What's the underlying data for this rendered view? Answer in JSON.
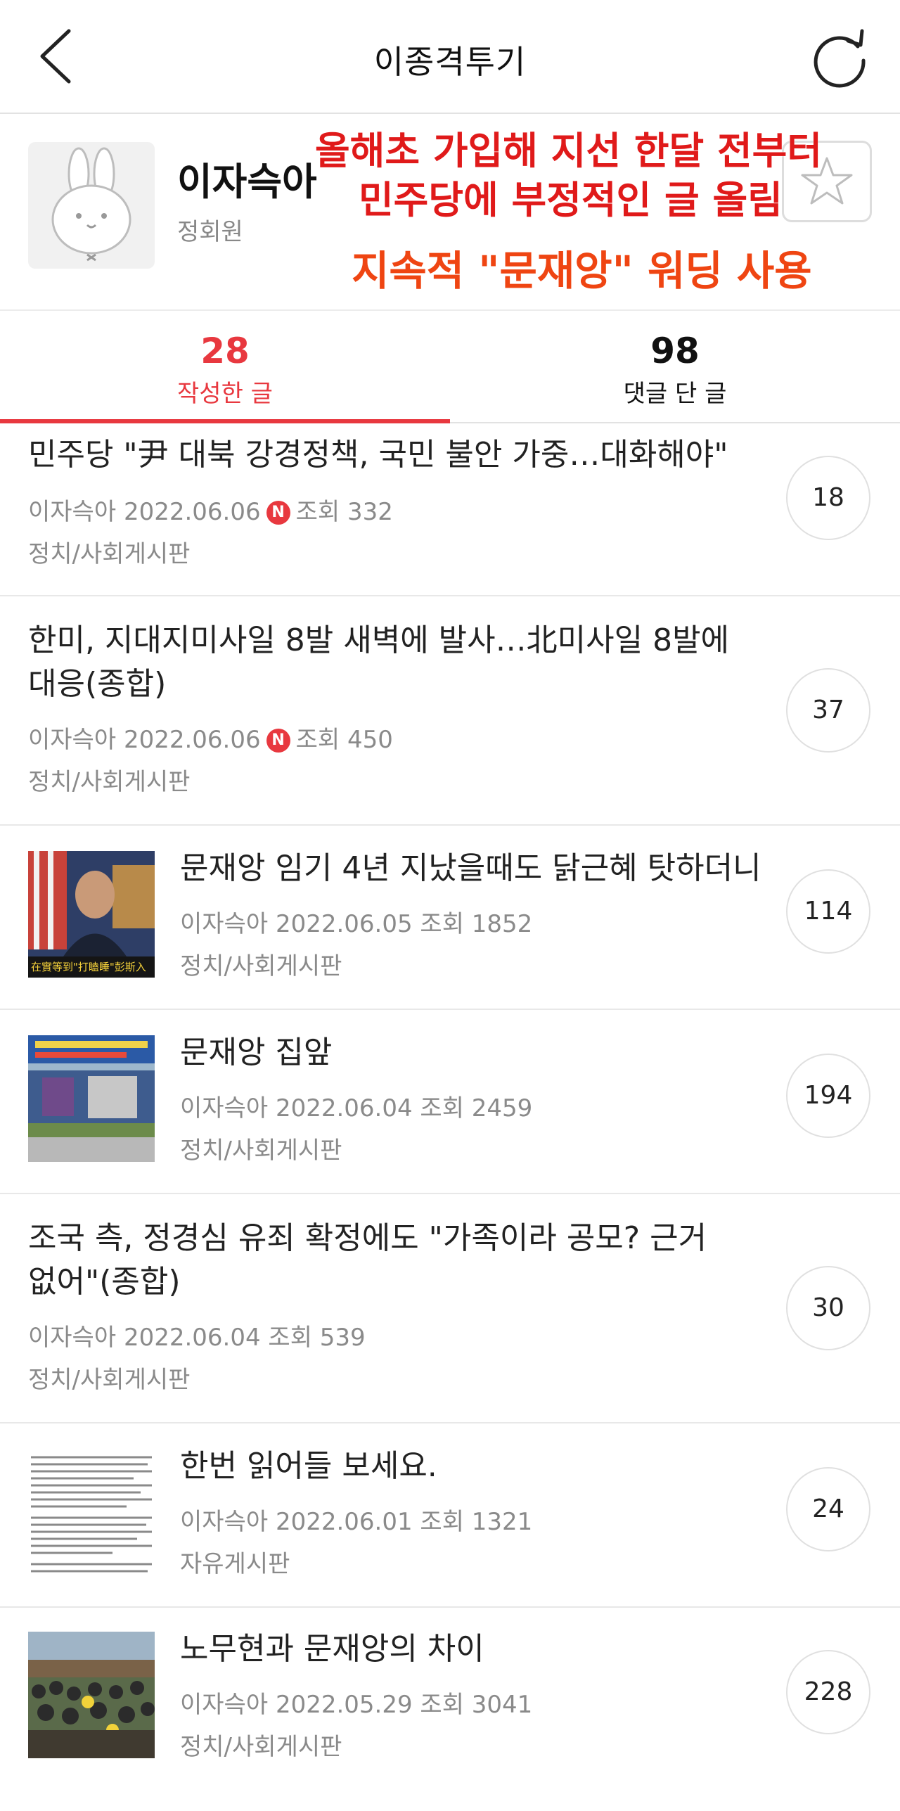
{
  "header": {
    "title": "이종격투기"
  },
  "profile": {
    "nickname": "이자슥아",
    "grade": "정회원"
  },
  "annotations": {
    "line1": "올해초 가입해 지선 한달 전부터",
    "line2": "민주당에 부정적인 글 올림",
    "line3": "지속적 \"문재앙\" 워딩 사용"
  },
  "tabs": [
    {
      "count": "28",
      "label": "작성한 글"
    },
    {
      "count": "98",
      "label": "댓글 단 글"
    }
  ],
  "posts": [
    {
      "title": "민주당 \"尹 대북 강경정책, 국민 불안 가중…대화해야\"",
      "author": "이자슥아",
      "date": "2022.06.06",
      "badge": "N",
      "views": "조회 332",
      "board": "정치/사회게시판",
      "comments": "18"
    },
    {
      "title_line1": "한미, 지대지미사일 8발 새벽에 발사…北미사일 8발에",
      "title_line2": "대응(종합)",
      "author": "이자슥아",
      "date": "2022.06.06",
      "badge": "N",
      "views": "조회 450",
      "board": "정치/사회게시판",
      "comments": "37"
    },
    {
      "title": "문재앙 임기 4년 지났을때도 닭근혜 탓하더니",
      "author": "이자슥아",
      "date": "2022.06.05",
      "views": "조회 1852",
      "board": "정치/사회게시판",
      "comments": "114",
      "thumb_caption": "在實等到\"打瞌睡\"彭斯入"
    },
    {
      "title": "문재앙 집앞",
      "author": "이자슥아",
      "date": "2022.06.04",
      "views": "조회 2459",
      "board": "정치/사회게시판",
      "comments": "194"
    },
    {
      "title_line1": "조국 측, 정경심 유죄 확정에도 \"가족이라 공모? 근거",
      "title_line2": "없어\"(종합)",
      "author": "이자슥아",
      "date": "2022.06.04",
      "views": "조회 539",
      "board": "정치/사회게시판",
      "comments": "30"
    },
    {
      "title": "한번 읽어들 보세요.",
      "author": "이자슥아",
      "date": "2022.06.01",
      "views": "조회 1321",
      "board": "자유게시판",
      "comments": "24"
    },
    {
      "title": "노무현과 문재앙의 차이",
      "author": "이자슥아",
      "date": "2022.05.29",
      "views": "조회 3041",
      "board": "정치/사회게시판",
      "comments": "228"
    }
  ],
  "colors": {
    "accent": "#e8383f",
    "annotation_red": "#e01a1a",
    "annotation_orange": "#ef4512"
  }
}
